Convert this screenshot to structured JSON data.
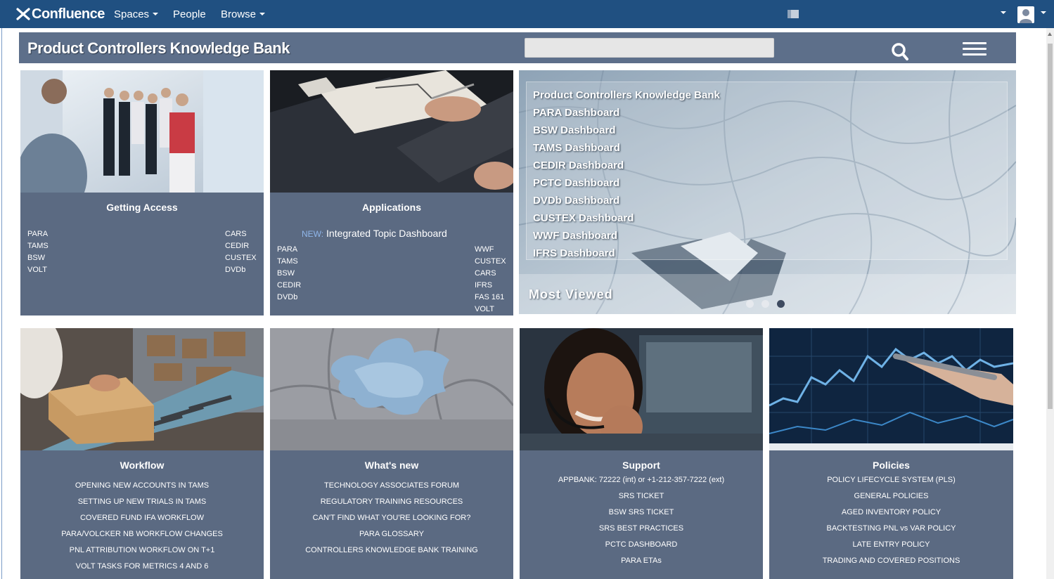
{
  "nav": {
    "logo": "Confluence",
    "spaces": "Spaces",
    "people": "People",
    "browse": "Browse"
  },
  "header": {
    "title": "Product Controllers Knowledge Bank",
    "search_placeholder": ""
  },
  "getting_access": {
    "title": "Getting Access",
    "left": [
      "PARA",
      "TAMS",
      "BSW",
      "VOLT"
    ],
    "right": [
      "CARS",
      "CEDIR",
      "CUSTEX",
      "DVDb"
    ]
  },
  "applications": {
    "title": "Applications",
    "new_tag": "NEW:",
    "new_link": "Integrated Topic Dashboard",
    "left": [
      "PARA",
      "TAMS",
      "BSW",
      "CEDIR",
      "DVDb"
    ],
    "right": [
      "WWF",
      "CUSTEX",
      "CARS",
      "IFRS",
      "FAS 161",
      "VOLT"
    ]
  },
  "carousel": {
    "links": [
      "Product Controllers Knowledge Bank",
      "PARA Dashboard",
      "BSW Dashboard",
      "TAMS Dashboard",
      "CEDIR Dashboard",
      "PCTC Dashboard",
      "DVDb Dashboard",
      "CUSTEX Dashboard",
      "WWF Dashboard",
      "IFRS Dashboard"
    ],
    "caption": "Most Viewed",
    "active_slide": 3
  },
  "workflow": {
    "title": "Workflow",
    "items": [
      "OPENING NEW ACCOUNTS IN TAMS",
      "SETTING UP NEW TRIALS IN TAMS",
      "COVERED FUND IFA WORKFLOW",
      "PARA/VOLCKER NB WORKFLOW CHANGES",
      "PNL ATTRIBUTION WORKFLOW ON T+1",
      "VOLT TASKS FOR METRICS 4 AND 6"
    ]
  },
  "whats_new": {
    "title": "What's new",
    "items": [
      "TECHNOLOGY ASSOCIATES FORUM",
      "REGULATORY TRAINING RESOURCES",
      "CAN'T FIND WHAT YOU'RE LOOKING FOR?",
      "PARA GLOSSARY",
      "CONTROLLERS KNOWLEDGE BANK TRAINING"
    ]
  },
  "support": {
    "title": "Support",
    "items": [
      "APPBANK: 72222 (int) or +1-212-357-7222 (ext)",
      "SRS TICKET",
      "BSW SRS TICKET",
      "SRS BEST PRACTICES",
      "PCTC DASHBOARD",
      "PARA ETAs"
    ]
  },
  "policies": {
    "title": "Policies",
    "items": [
      "POLICY LIFECYCLE SYSTEM (PLS)",
      "GENERAL POLICIES",
      "AGED INVENTORY POLICY",
      "BACKTESTING PNL vs VAR POLICY",
      "LATE ENTRY POLICY",
      "TRADING AND COVERED POSITIONS"
    ]
  },
  "colors": {
    "nav": "#205081",
    "tile": "#5b6a82",
    "header": "#5d6f8a"
  }
}
